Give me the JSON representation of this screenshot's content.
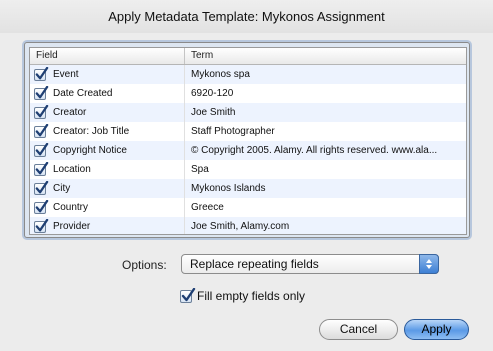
{
  "window": {
    "title": "Apply Metadata Template: Mykonos Assignment"
  },
  "table": {
    "columns": [
      "Field",
      "Term"
    ],
    "rows": [
      {
        "field": "Event",
        "term": "Mykonos spa",
        "checked": true
      },
      {
        "field": "Date Created",
        "term": "6920-120",
        "checked": true
      },
      {
        "field": "Creator",
        "term": "Joe Smith",
        "checked": true
      },
      {
        "field": "Creator: Job Title",
        "term": "Staff Photographer",
        "checked": true
      },
      {
        "field": "Copyright Notice",
        "term": "© Copyright 2005. Alamy. All rights reserved. www.ala...",
        "checked": true
      },
      {
        "field": "Location",
        "term": "Spa",
        "checked": true
      },
      {
        "field": "City",
        "term": "Mykonos Islands",
        "checked": true
      },
      {
        "field": "Country",
        "term": "Greece",
        "checked": true
      },
      {
        "field": "Provider",
        "term": "Joe Smith, Alamy.com",
        "checked": true
      }
    ]
  },
  "options": {
    "label": "Options:",
    "selected": "Replace repeating fields"
  },
  "fill_empty": {
    "label": "Fill empty fields only",
    "checked": true
  },
  "buttons": {
    "cancel": "Cancel",
    "apply": "Apply"
  },
  "colors": {
    "accent": "#3d7fd4",
    "checkmark": "#1f3f73",
    "alt_row": "#edf3fe"
  }
}
